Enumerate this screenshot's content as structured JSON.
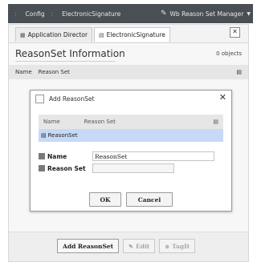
{
  "topbar": {
    "crumb1": "Config",
    "crumb2": "ElectronicSignature",
    "manager": "Wb Reason Set Manager",
    "pen_icon": "pen-icon",
    "arrow_icon": "chevron-down-icon"
  },
  "tabs": [
    {
      "label": "Application Director",
      "icon": "app-director-icon"
    },
    {
      "label": "ElectronicSignature",
      "icon": "folder-icon"
    }
  ],
  "close_tab_label": "✕",
  "main": {
    "title": "ReasonSet Information",
    "object_count": "0 objects",
    "columns": [
      "Name",
      "Reason Set"
    ],
    "menu_glyph": "▤"
  },
  "dialog": {
    "title": "Add ReasonSet",
    "close": "✕",
    "columns": [
      "Name",
      "Reason Set"
    ],
    "row": "ReasonSet",
    "fields": {
      "name_label": "Name",
      "name_value": "ReasonSet",
      "reason_label": "Reason Set",
      "reason_value": ""
    },
    "ok": "OK",
    "cancel": "Cancel"
  },
  "bottom_buttons": {
    "add": "Add ReasonSet",
    "edit": "Edit",
    "tagit": "TagIt"
  }
}
